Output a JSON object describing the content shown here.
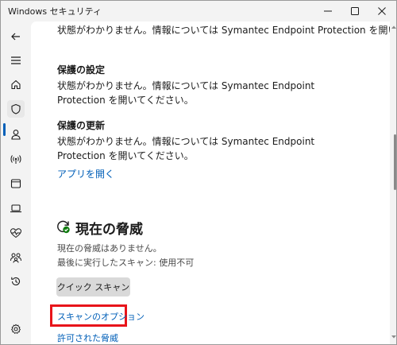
{
  "window": {
    "title": "Windows セキュリティ"
  },
  "sidebar": {
    "items": [
      {
        "icon": "back-arrow-icon"
      },
      {
        "icon": "hamburger-menu-icon"
      },
      {
        "icon": "home-icon"
      },
      {
        "icon": "shield-icon",
        "active": true
      },
      {
        "icon": "person-icon"
      },
      {
        "icon": "wireless-signal-icon"
      },
      {
        "icon": "app-window-icon"
      },
      {
        "icon": "laptop-icon"
      },
      {
        "icon": "heart-pulse-icon"
      },
      {
        "icon": "family-icon"
      },
      {
        "icon": "history-icon"
      },
      {
        "icon": "settings-gear-icon"
      }
    ]
  },
  "main": {
    "top_text": "状態がわかりません。情報については Symantec Endpoint Protection を開いて",
    "protection_settings": {
      "heading": "保護の設定",
      "text": "状態がわかりません。情報については Symantec Endpoint Protection を開いてください。"
    },
    "protection_updates": {
      "heading": "保護の更新",
      "text": "状態がわかりません。情報については Symantec Endpoint Protection を開いてください。"
    },
    "open_app_link": "アプリを開く",
    "threats": {
      "title": "現在の脅威",
      "status": "現在の脅威はありません。",
      "last_scan": "最後に実行したスキャン: 使用不可",
      "quick_scan_label": "クイック スキャン",
      "scan_options_link": "スキャンのオプション",
      "allowed_threats_link": "許可された脅威"
    }
  },
  "colors": {
    "accent": "#005fb8",
    "highlight": "#e8141a",
    "background": "#f3f3f3",
    "content": "#ffffff"
  }
}
